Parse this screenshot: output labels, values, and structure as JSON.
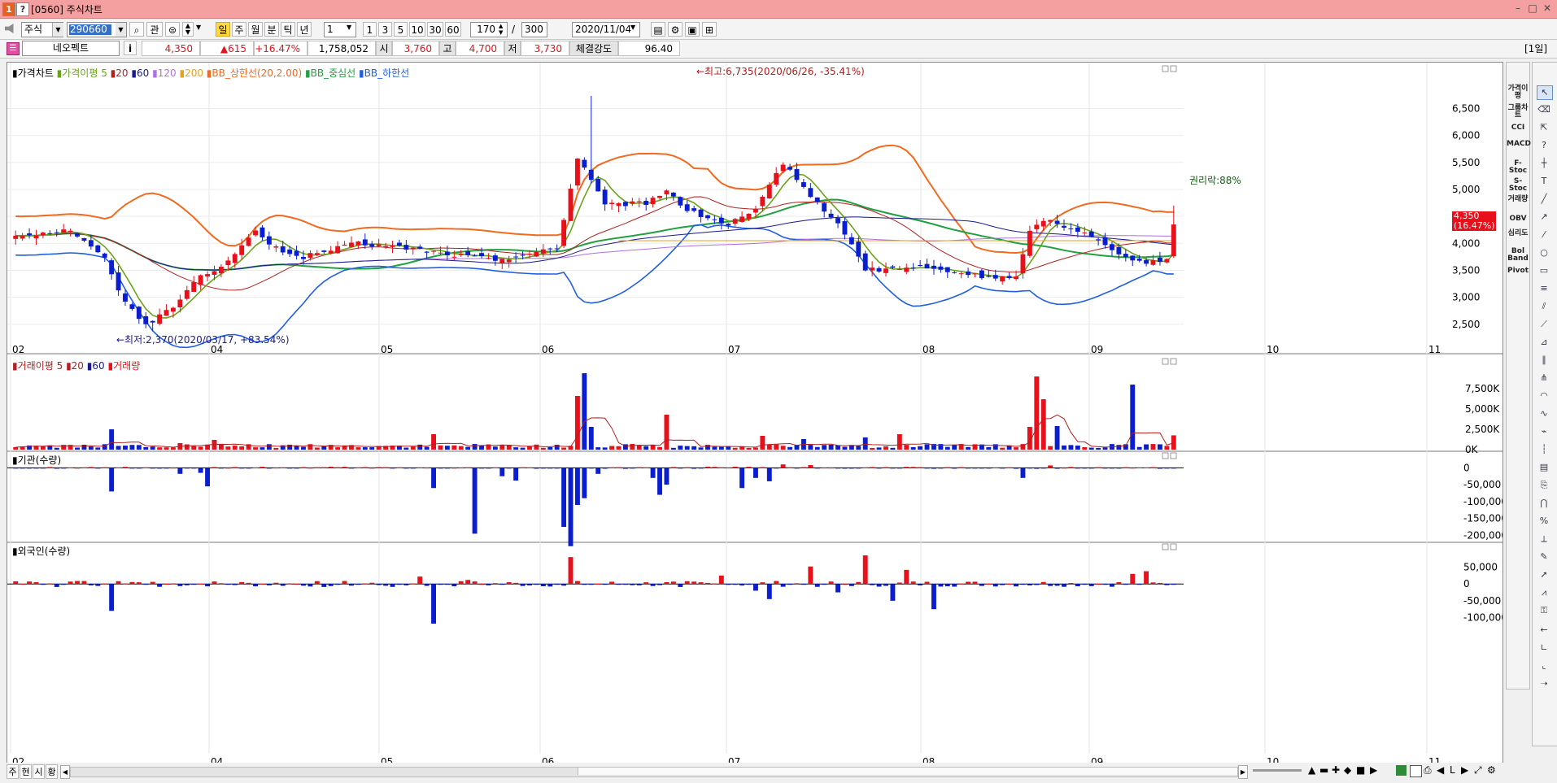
{
  "window": {
    "icon1": "1",
    "icon2": "?",
    "title": "[0560] 주식차트",
    "min": "–",
    "max": "□",
    "close": "✕"
  },
  "toolbar": {
    "market": "주식",
    "code": "290660",
    "search_glyph": "⌕",
    "gwan": "관",
    "periods": [
      "주",
      "월",
      "분",
      "틱",
      "년"
    ],
    "period_hl": "일",
    "tick_value": "1",
    "intervals": [
      "1",
      "3",
      "5",
      "10",
      "30",
      "60"
    ],
    "count": "170",
    "slash": "/",
    "total": "300",
    "date": "2020/11/04"
  },
  "quote": {
    "name": "네오펙트",
    "info": "i",
    "price": "4,350",
    "change": "▲615",
    "change_pct": "+16.47%",
    "volume": "1,758,052",
    "open_label": "시",
    "open": "3,760",
    "high_label": "고",
    "high": "4,700",
    "low_label": "저",
    "low": "3,730",
    "strength_label": "체결강도",
    "strength": "96.40",
    "period_tag": "[1일]"
  },
  "legend": {
    "price": "가격차트",
    "ma_prefix": "가격이평 5",
    "ma20": "20",
    "ma60": "60",
    "ma120": "120",
    "ma200": "200",
    "bb_upper": "BB_상한선(20,2.00)",
    "bb_mid": "BB_중심선",
    "bb_lower": "BB_하한선",
    "volume_prefix": "거래이평 5",
    "vol20": "20",
    "vol60": "60",
    "volume": "거래량",
    "inst": "기관(수량)",
    "foreign": "외국인(수량)"
  },
  "annotations": {
    "high": "←최고:6,735(2020/06/26, -35.41%)",
    "low": "←최저:2,370(2020/03/17, +83.54%)",
    "rights": "권리락:88%",
    "last_price": "4,350",
    "last_pct": "(16.47%)"
  },
  "colors": {
    "up": "#e8101a",
    "down": "#0a1ed0",
    "ma5": "#6aa31a",
    "ma20": "#b02020",
    "ma60": "#1a1a8c",
    "ma120": "#b070e0",
    "ma200": "#e8a020",
    "bb_upper": "#f06a20",
    "bb_mid": "#20a040",
    "bb_lower": "#2060e0",
    "titlebar": "#f5a0a0"
  },
  "right_indicators": [
    "가격이평",
    "그룹차트",
    "CCI",
    "MACD",
    "F-Stoc",
    "S-Stoc",
    "거래량",
    "OBV",
    "심리도",
    "Bol Band",
    "Pivot"
  ],
  "bottom_tabs": [
    "주",
    "현",
    "시",
    "황"
  ],
  "chart_data": [
    {
      "type": "candlestick",
      "x_ticks": [
        "02",
        "04",
        "05",
        "06",
        "07",
        "08",
        "09",
        "10",
        "11"
      ],
      "y_ticks": [
        2500,
        3000,
        3500,
        4000,
        4500,
        5000,
        5500,
        6000,
        6500
      ],
      "y_labels": [
        "2,500",
        "3,000",
        "3,500",
        "4,000",
        "4,500",
        "5,000",
        "5,500",
        "6,000",
        "6,500"
      ],
      "ylim": [
        2150,
        7050
      ],
      "days": 170,
      "grid": true,
      "key_points": [
        {
          "i": 0,
          "close": 4150
        },
        {
          "i": 8,
          "close": 4250
        },
        {
          "i": 13,
          "close": 3700
        },
        {
          "i": 16,
          "close": 2900
        },
        {
          "i": 19,
          "close": 2500
        },
        {
          "i": 23,
          "close": 2800
        },
        {
          "i": 26,
          "close": 3300
        },
        {
          "i": 30,
          "close": 3600
        },
        {
          "i": 35,
          "close": 4200
        },
        {
          "i": 38,
          "close": 3900
        },
        {
          "i": 42,
          "close": 3750
        },
        {
          "i": 50,
          "close": 4000
        },
        {
          "i": 58,
          "close": 3900
        },
        {
          "i": 63,
          "close": 3800
        },
        {
          "i": 70,
          "close": 3700
        },
        {
          "i": 79,
          "close": 3900
        },
        {
          "i": 82,
          "close": 5600
        },
        {
          "i": 84,
          "close": 5200
        },
        {
          "i": 86,
          "close": 4700
        },
        {
          "i": 92,
          "close": 4750
        },
        {
          "i": 95,
          "close": 5000
        },
        {
          "i": 98,
          "close": 4600
        },
        {
          "i": 104,
          "close": 4350
        },
        {
          "i": 108,
          "close": 4600
        },
        {
          "i": 112,
          "close": 5500
        },
        {
          "i": 116,
          "close": 4900
        },
        {
          "i": 121,
          "close": 4200
        },
        {
          "i": 124,
          "close": 3500
        },
        {
          "i": 132,
          "close": 3550
        },
        {
          "i": 140,
          "close": 3400
        },
        {
          "i": 146,
          "close": 3350
        },
        {
          "i": 148,
          "close": 4200
        },
        {
          "i": 150,
          "close": 4450
        },
        {
          "i": 155,
          "close": 4250
        },
        {
          "i": 160,
          "close": 3900
        },
        {
          "i": 165,
          "close": 3600
        },
        {
          "i": 168,
          "close": 3735
        },
        {
          "i": 169,
          "close": 4350
        }
      ],
      "high_mark": {
        "i": 84,
        "value": 6735
      },
      "low_mark": {
        "i": 20,
        "value": 2370
      }
    },
    {
      "type": "bar",
      "name": "거래량",
      "y_labels": [
        "7,500K",
        "5,000K",
        "2,500K",
        "0K"
      ],
      "y_values": [
        7500,
        5000,
        2500,
        0
      ],
      "ylim": [
        0,
        10000
      ],
      "spikes": [
        {
          "i": 14,
          "v": 2500
        },
        {
          "i": 24,
          "v": 800
        },
        {
          "i": 29,
          "v": 1200
        },
        {
          "i": 61,
          "v": 1900
        },
        {
          "i": 82,
          "v": 6600
        },
        {
          "i": 83,
          "v": 9400
        },
        {
          "i": 84,
          "v": 2800
        },
        {
          "i": 95,
          "v": 4300
        },
        {
          "i": 109,
          "v": 1700
        },
        {
          "i": 115,
          "v": 1300
        },
        {
          "i": 124,
          "v": 1500
        },
        {
          "i": 129,
          "v": 1900
        },
        {
          "i": 148,
          "v": 2800
        },
        {
          "i": 149,
          "v": 9000
        },
        {
          "i": 150,
          "v": 6200
        },
        {
          "i": 152,
          "v": 2900
        },
        {
          "i": 163,
          "v": 8000
        },
        {
          "i": 169,
          "v": 1758
        }
      ]
    },
    {
      "type": "bar",
      "name": "기관(수량)",
      "y_labels": [
        "0",
        "-50,000",
        "-100,000",
        "-150,000",
        "-200,000"
      ],
      "y_values": [
        0,
        -50000,
        -100000,
        -150000,
        -200000
      ],
      "ylim": [
        -235000,
        20000
      ],
      "spikes": [
        {
          "i": 14,
          "v": -70000
        },
        {
          "i": 28,
          "v": -55000
        },
        {
          "i": 24,
          "v": -18000
        },
        {
          "i": 27,
          "v": -15000
        },
        {
          "i": 61,
          "v": -60000
        },
        {
          "i": 67,
          "v": -195000
        },
        {
          "i": 71,
          "v": -25000
        },
        {
          "i": 73,
          "v": -38000
        },
        {
          "i": 80,
          "v": -175000
        },
        {
          "i": 81,
          "v": -232000
        },
        {
          "i": 82,
          "v": -110000
        },
        {
          "i": 83,
          "v": -90000
        },
        {
          "i": 85,
          "v": -18000
        },
        {
          "i": 93,
          "v": -30000
        },
        {
          "i": 94,
          "v": -80000
        },
        {
          "i": 95,
          "v": -50000
        },
        {
          "i": 106,
          "v": -60000
        },
        {
          "i": 108,
          "v": -30000
        },
        {
          "i": 110,
          "v": -40000
        },
        {
          "i": 112,
          "v": 10000
        },
        {
          "i": 116,
          "v": 8000
        },
        {
          "i": 147,
          "v": -30000
        },
        {
          "i": 151,
          "v": 7000
        }
      ]
    },
    {
      "type": "bar",
      "name": "외국인(수량)",
      "y_labels": [
        "50,000",
        "0",
        "-50,000",
        "-100,000"
      ],
      "y_values": [
        50000,
        0,
        -50000,
        -100000
      ],
      "ylim": [
        -118000,
        90000
      ],
      "spikes": [
        {
          "i": 14,
          "v": -80000
        },
        {
          "i": 59,
          "v": 22000
        },
        {
          "i": 61,
          "v": -118000
        },
        {
          "i": 66,
          "v": 12000
        },
        {
          "i": 80,
          "v": -5000
        },
        {
          "i": 81,
          "v": -95000
        },
        {
          "i": 81,
          "v": 80000
        },
        {
          "i": 103,
          "v": 25000
        },
        {
          "i": 108,
          "v": -20000
        },
        {
          "i": 110,
          "v": -45000
        },
        {
          "i": 116,
          "v": 52000
        },
        {
          "i": 120,
          "v": -25000
        },
        {
          "i": 124,
          "v": 85000
        },
        {
          "i": 128,
          "v": -50000
        },
        {
          "i": 130,
          "v": 42000
        },
        {
          "i": 134,
          "v": -75000
        },
        {
          "i": 163,
          "v": 30000
        },
        {
          "i": 165,
          "v": 38000
        }
      ]
    }
  ]
}
